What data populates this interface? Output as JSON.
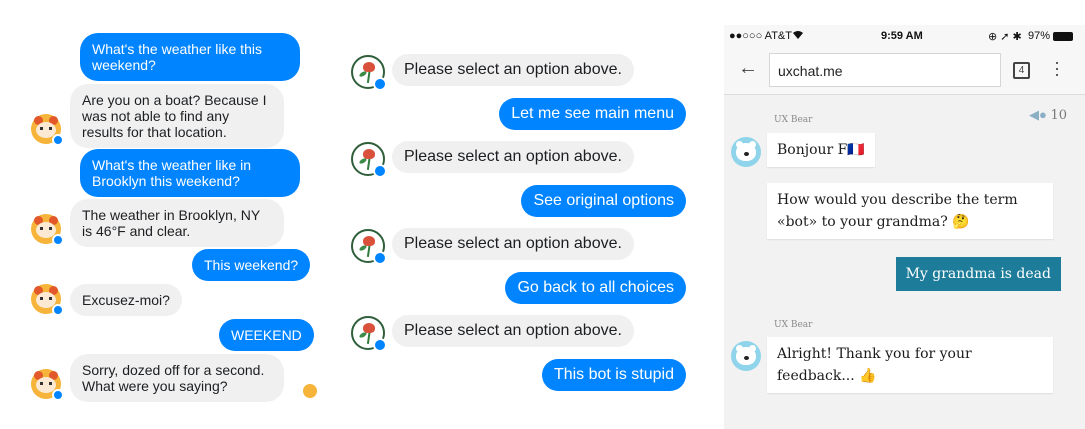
{
  "panel1": {
    "messages": [
      {
        "text": "What's the weather like this weekend?"
      },
      {
        "text": "Are you on a boat? Because I was not able to find any results for that location."
      },
      {
        "text": "What's the weather like in Brooklyn this weekend?"
      },
      {
        "text": "The weather in Brooklyn, NY is 46°F and clear."
      },
      {
        "text": "This weekend?"
      },
      {
        "text": "Excusez-moi?"
      },
      {
        "text": "WEEKEND"
      },
      {
        "text": "Sorry, dozed off for a second. What were you saying?"
      }
    ]
  },
  "panel2": {
    "messages": [
      {
        "text": "Please select an option above."
      },
      {
        "text": "Let me see main menu"
      },
      {
        "text": "Please select an option above."
      },
      {
        "text": "See original options"
      },
      {
        "text": "Please select an option above."
      },
      {
        "text": "Go back to all choices"
      },
      {
        "text": "Please select an option above."
      },
      {
        "text": "This bot is stupid"
      }
    ]
  },
  "panel3": {
    "status": {
      "carrier": "●●○○○ AT&T",
      "time": "9:59 AM",
      "battery": "97%"
    },
    "url": "uxchat.me",
    "tab_count": "4",
    "sender": "UX Bear",
    "score": "10",
    "messages": [
      {
        "text": "Bonjour F🇫🇷"
      },
      {
        "text": "How would you describe the term «bot» to your grandma? 🤔"
      },
      {
        "text": "My grandma is dead"
      },
      {
        "text": "Alright! Thank you for your feedback... 👍"
      }
    ]
  },
  "colors": {
    "messenger_blue": "#0084ff",
    "incoming_gray": "#f0f0f0",
    "uxchat_teal": "#1c7c99"
  }
}
